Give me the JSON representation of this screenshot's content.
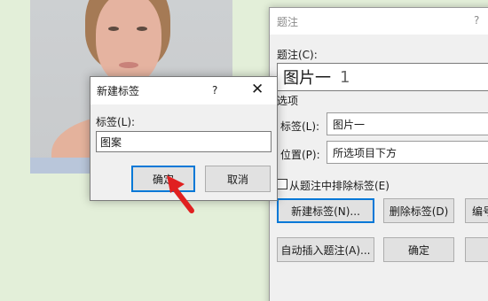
{
  "new_label_dialog": {
    "title": "新建标签",
    "help": "?",
    "close": "✕",
    "label_prompt": "标签(L):",
    "label_value": "图案",
    "ok": "确定",
    "cancel": "取消"
  },
  "caption_dialog": {
    "title": "题注",
    "help": "?",
    "caption_label": "题注(C):",
    "caption_value": "图片一",
    "caption_number": "1",
    "options_label": "选项",
    "label_label": "标签(L):",
    "label_value": "图片一",
    "position_label": "位置(P):",
    "position_value": "所选项目下方",
    "exclude_label": "从题注中排除标签(E)",
    "new_label_button": "新建标签(N)...",
    "delete_label_button": "删除标签(D)",
    "numbering_button": "编号",
    "autocaption_button": "自动插入题注(A)...",
    "ok_button": "确定"
  },
  "colors": {
    "background": "#e3efd9",
    "arrow": "#e02020",
    "focus_border": "#0078d7"
  }
}
